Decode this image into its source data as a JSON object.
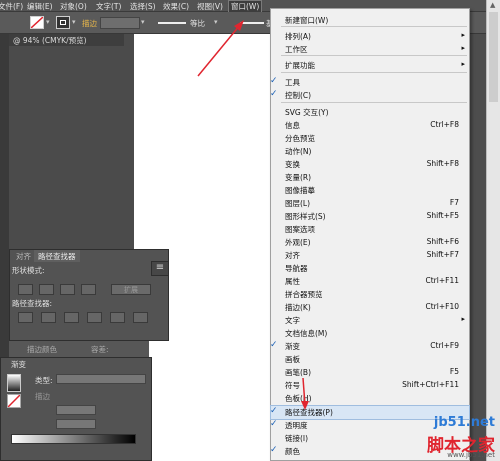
{
  "menubar": {
    "items": [
      "文件(F)",
      "编辑(E)",
      "对象(O)",
      "文字(T)",
      "选择(S)",
      "效果(C)",
      "视图(V)",
      "窗口(W)"
    ],
    "active": "窗口(W)"
  },
  "control_bar": {
    "stroke_label": "描边",
    "profile_label": "等比",
    "basic_label": "基本"
  },
  "document_tab": {
    "title": "@ 94% (CMYK/预览)"
  },
  "pathfinder_panel": {
    "tab_align": "对齐",
    "tab_pathfinder": "路径查找器",
    "shape_modes_label": "形状模式:",
    "pathfinders_label": "路径查找器:",
    "expand_button": "扩展"
  },
  "stroke_panel_peek": {
    "label1": "描边颜色",
    "label2": "容差:"
  },
  "gradient_panel": {
    "title": "渐变",
    "type_label": "类型:",
    "stroke_label": "描边",
    "gradient_colors": [
      "#ffffff",
      "#000000"
    ]
  },
  "window_menu": {
    "items": [
      {
        "label": "新建窗口(W)",
        "shortcut": "",
        "checked": false,
        "submenu": false
      },
      {
        "label": "排列(A)",
        "shortcut": "",
        "checked": false,
        "submenu": true
      },
      {
        "label": "工作区",
        "shortcut": "",
        "checked": false,
        "submenu": true
      },
      {
        "label": "扩展功能",
        "shortcut": "",
        "checked": false,
        "submenu": true
      },
      {
        "label": "工具",
        "shortcut": "",
        "checked": true,
        "submenu": false
      },
      {
        "label": "控制(C)",
        "shortcut": "",
        "checked": true,
        "submenu": false
      },
      {
        "label": "SVG 交互(Y)",
        "shortcut": "",
        "checked": false,
        "submenu": false
      },
      {
        "label": "信息",
        "shortcut": "Ctrl+F8",
        "checked": false,
        "submenu": false
      },
      {
        "label": "分色预览",
        "shortcut": "",
        "checked": false,
        "submenu": false
      },
      {
        "label": "动作(N)",
        "shortcut": "",
        "checked": false,
        "submenu": false
      },
      {
        "label": "变换",
        "shortcut": "Shift+F8",
        "checked": false,
        "submenu": false
      },
      {
        "label": "变量(R)",
        "shortcut": "",
        "checked": false,
        "submenu": false
      },
      {
        "label": "图像描摹",
        "shortcut": "",
        "checked": false,
        "submenu": false
      },
      {
        "label": "图层(L)",
        "shortcut": "F7",
        "checked": false,
        "submenu": false
      },
      {
        "label": "图形样式(S)",
        "shortcut": "Shift+F5",
        "checked": false,
        "submenu": false
      },
      {
        "label": "图案选项",
        "shortcut": "",
        "checked": false,
        "submenu": false
      },
      {
        "label": "外观(E)",
        "shortcut": "Shift+F6",
        "checked": false,
        "submenu": false
      },
      {
        "label": "对齐",
        "shortcut": "Shift+F7",
        "checked": false,
        "submenu": false
      },
      {
        "label": "导航器",
        "shortcut": "",
        "checked": false,
        "submenu": false
      },
      {
        "label": "属性",
        "shortcut": "Ctrl+F11",
        "checked": false,
        "submenu": false
      },
      {
        "label": "拼合器预览",
        "shortcut": "",
        "checked": false,
        "submenu": false
      },
      {
        "label": "描边(K)",
        "shortcut": "Ctrl+F10",
        "checked": false,
        "submenu": false
      },
      {
        "label": "文字",
        "shortcut": "",
        "checked": false,
        "submenu": true
      },
      {
        "label": "文档信息(M)",
        "shortcut": "",
        "checked": false,
        "submenu": false
      },
      {
        "label": "渐变",
        "shortcut": "Ctrl+F9",
        "checked": true,
        "submenu": false
      },
      {
        "label": "画板",
        "shortcut": "",
        "checked": false,
        "submenu": false
      },
      {
        "label": "画笔(B)",
        "shortcut": "F5",
        "checked": false,
        "submenu": false
      },
      {
        "label": "符号",
        "shortcut": "Shift+Ctrl+F11",
        "checked": false,
        "submenu": false
      },
      {
        "label": "色板(H)",
        "shortcut": "",
        "checked": false,
        "submenu": false
      },
      {
        "label": "路径查找器(P)",
        "shortcut": "",
        "checked": true,
        "submenu": false,
        "highlighted": true
      },
      {
        "label": "透明度",
        "shortcut": "",
        "checked": true,
        "submenu": false
      },
      {
        "label": "链接(I)",
        "shortcut": "",
        "checked": false,
        "submenu": false
      },
      {
        "label": "颜色",
        "shortcut": "",
        "checked": true,
        "submenu": false
      }
    ]
  },
  "watermark": {
    "site": "jb51.net",
    "brand": "脚本之家",
    "url": "www.jb51.net"
  },
  "colors": {
    "menu_bg": "#f0f0f0",
    "check": "#1a5fb4",
    "annotation_arrow": "#e0252f",
    "ui_dark": "#535353"
  }
}
